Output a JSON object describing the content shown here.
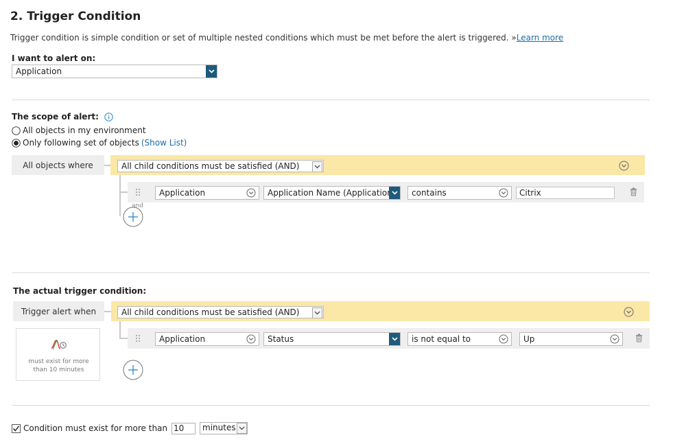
{
  "section": {
    "title": "2. Trigger Condition",
    "description": "Trigger condition is simple condition or set of multiple nested conditions which must be met before the alert is triggered.",
    "learn_more_prefix": "»",
    "learn_more": "Learn more"
  },
  "alert_on": {
    "label": "I want to alert on:",
    "value": "Application"
  },
  "scope": {
    "label": "The scope of alert:",
    "option_all": "All objects in my environment",
    "option_following": "Only following set of objects",
    "show_list": "(Show List)",
    "selected": "following",
    "group_label": "All objects where",
    "group_operator": "All child conditions must be satisfied (AND)",
    "condition": {
      "object": "Application",
      "field": "Application Name (Application A",
      "operator": "contains",
      "value": "Citrix"
    },
    "and_label": "and"
  },
  "trigger": {
    "label": "The actual trigger condition:",
    "group_label": "Trigger alert when",
    "group_operator": "All child conditions must be satisfied (AND)",
    "condition": {
      "object": "Application",
      "field": "Status",
      "operator": "is not equal to",
      "value": "Up"
    },
    "summary": "must exist for more than 10 minutes"
  },
  "duration": {
    "checked": true,
    "label": "Condition must exist for more than",
    "value": "10",
    "unit": "minutes"
  },
  "colors": {
    "band": "#fbe7a6",
    "accent": "#1e5a7c",
    "link": "#1a6ea8"
  }
}
